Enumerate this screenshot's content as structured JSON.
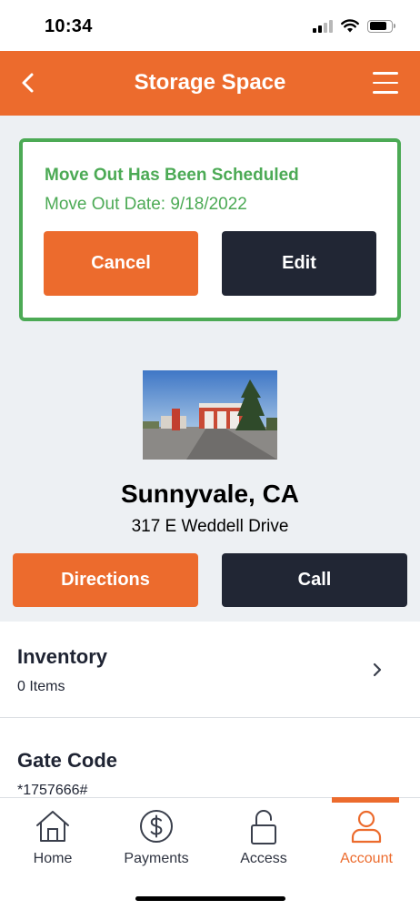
{
  "status_bar": {
    "time": "10:34"
  },
  "header": {
    "title": "Storage Space"
  },
  "moveout": {
    "title": "Move Out Has Been Scheduled",
    "date_label": "Move Out Date: 9/18/2022",
    "cancel_label": "Cancel",
    "edit_label": "Edit"
  },
  "facility": {
    "name": "Sunnyvale, CA",
    "address": "317 E Weddell Drive",
    "directions_label": "Directions",
    "call_label": "Call"
  },
  "inventory": {
    "title": "Inventory",
    "count": "0 Items"
  },
  "gate": {
    "title": "Gate Code",
    "code": "*1757666#"
  },
  "tabs": [
    {
      "label": "Home",
      "icon": "home-icon"
    },
    {
      "label": "Payments",
      "icon": "dollar-circle-icon"
    },
    {
      "label": "Access",
      "icon": "unlock-icon"
    },
    {
      "label": "Account",
      "icon": "user-icon"
    }
  ],
  "active_tab": "Account",
  "colors": {
    "brand": "#ec6b2d",
    "dark": "#212634",
    "success": "#4caa55",
    "background": "#edf0f3"
  }
}
